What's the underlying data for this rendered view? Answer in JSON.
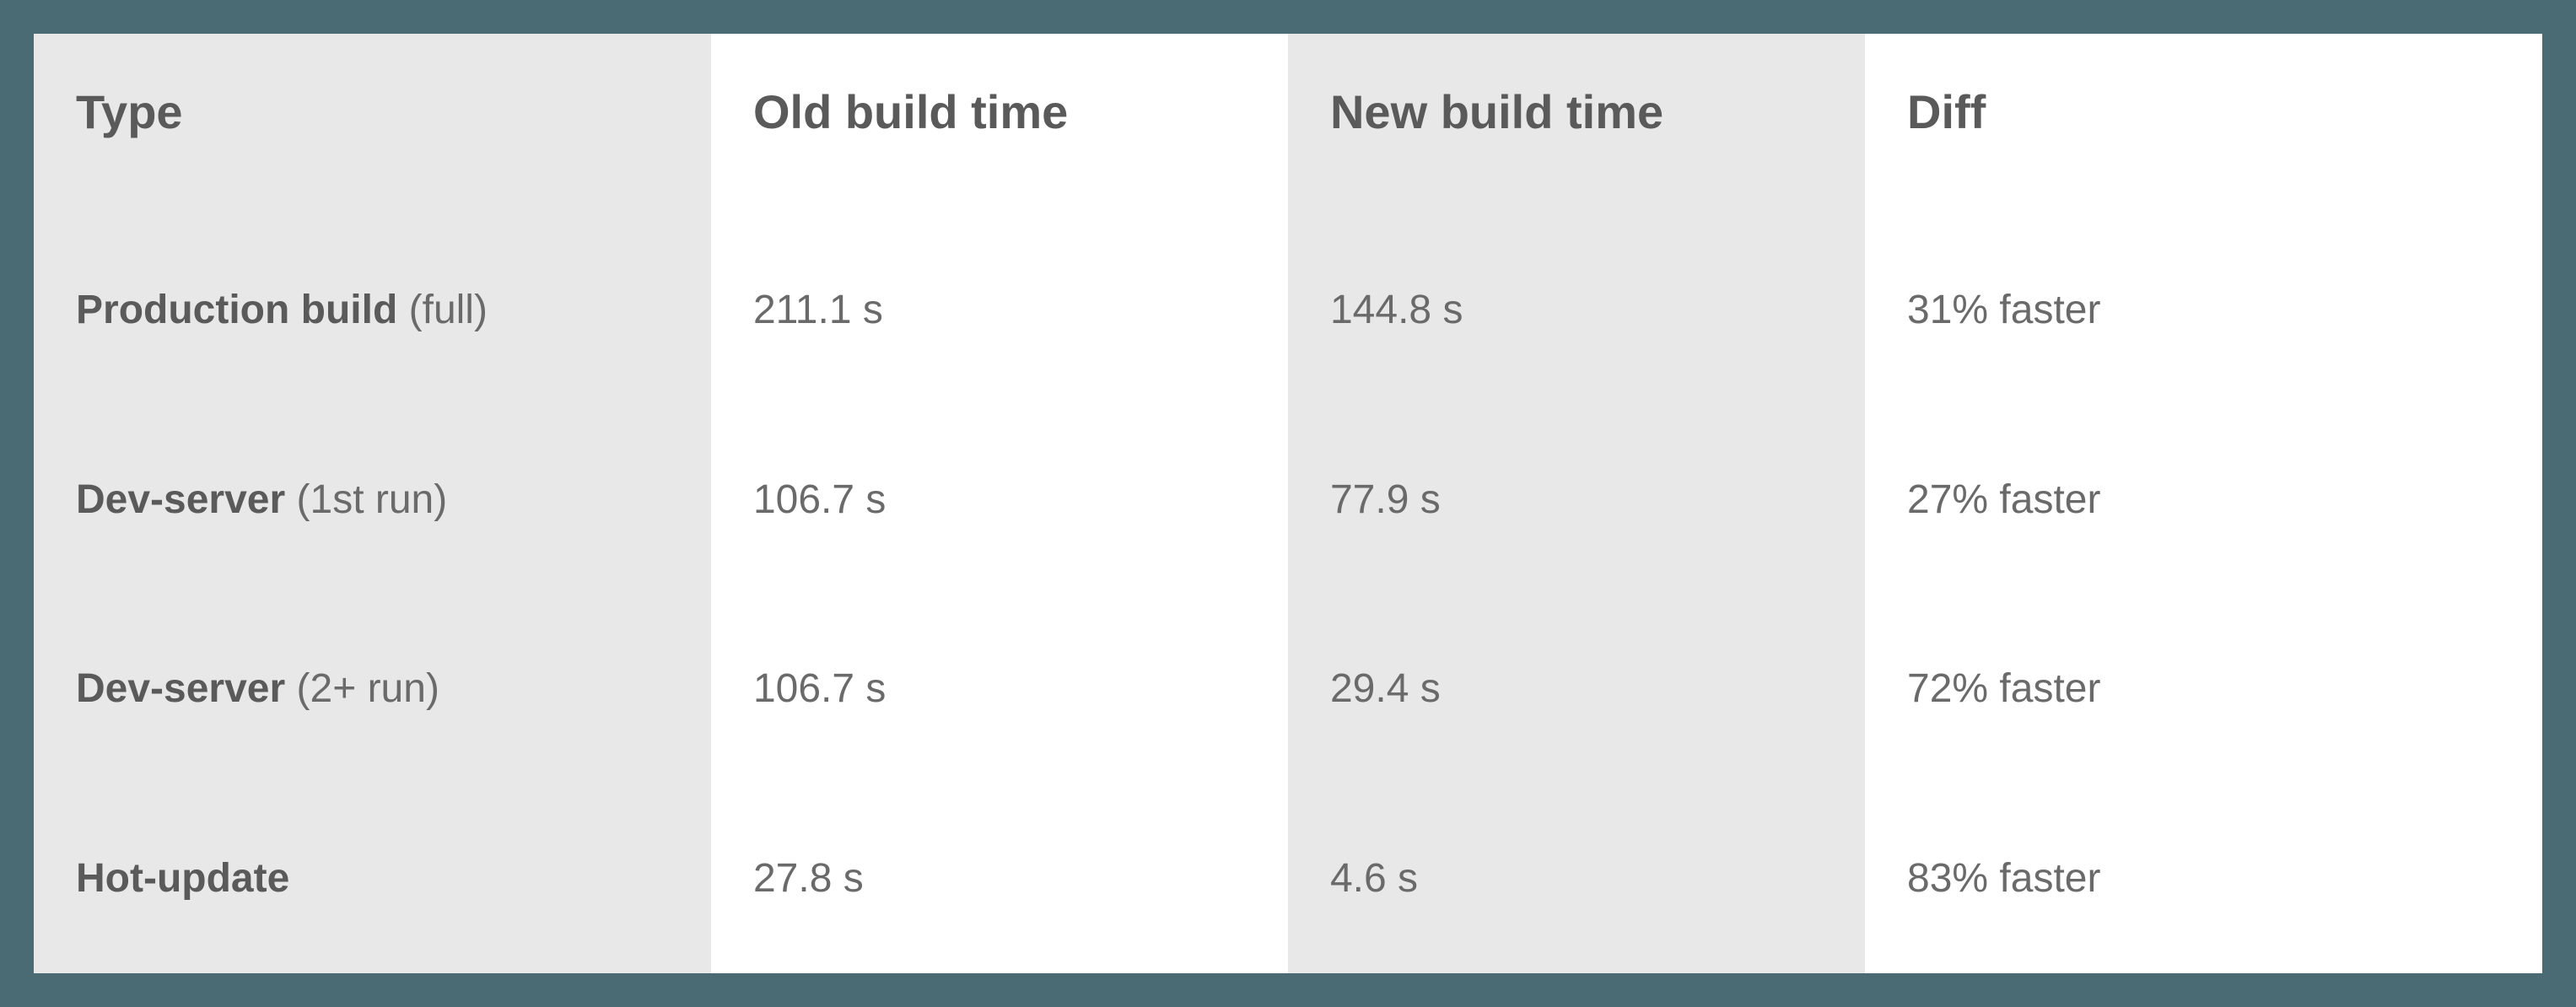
{
  "chart_data": {
    "type": "table",
    "columns": [
      "Type",
      "Old build time",
      "New build time",
      "Diff"
    ],
    "rows": [
      {
        "type_bold": "Production build",
        "type_suffix": " (full)",
        "old": "211.1 s",
        "new": "144.8 s",
        "diff": "31% faster"
      },
      {
        "type_bold": "Dev-server",
        "type_suffix": " (1st run)",
        "old": "106.7 s",
        "new": "77.9 s",
        "diff": "27% faster"
      },
      {
        "type_bold": "Dev-server",
        "type_suffix": " (2+ run)",
        "old": "106.7 s",
        "new": "29.4 s",
        "diff": "72% faster"
      },
      {
        "type_bold": "Hot-update",
        "type_suffix": "",
        "old": "27.8 s",
        "new": "4.6 s",
        "diff": "83% faster"
      }
    ]
  }
}
